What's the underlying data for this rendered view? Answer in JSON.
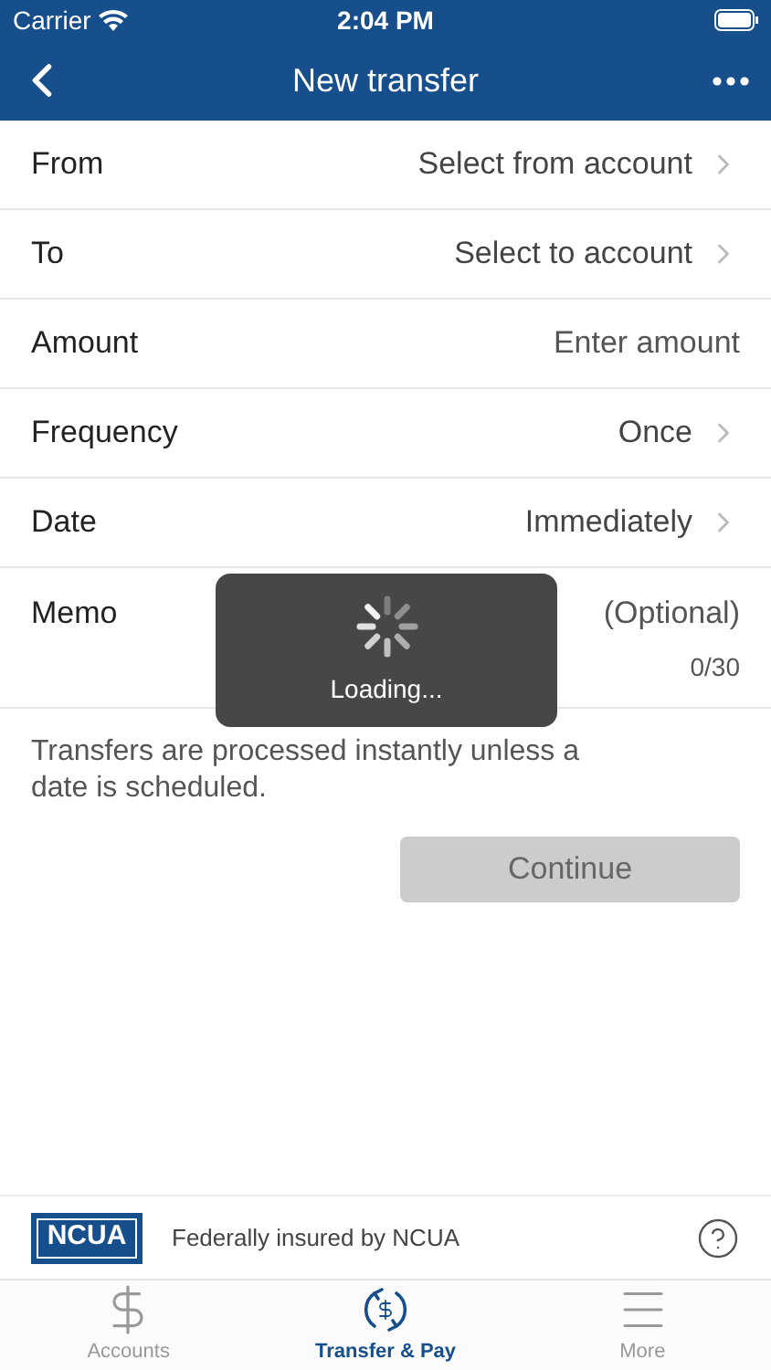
{
  "status_bar": {
    "carrier": "Carrier",
    "time": "2:04 PM"
  },
  "nav": {
    "title": "New transfer"
  },
  "rows": [
    {
      "kind": "select",
      "label": "From",
      "value": "Select from account"
    },
    {
      "kind": "select",
      "label": "To",
      "value": "Select to account"
    },
    {
      "kind": "input",
      "label": "Amount",
      "placeholder": "Enter amount"
    },
    {
      "kind": "select",
      "label": "Frequency",
      "value": "Once"
    },
    {
      "kind": "select",
      "label": "Date",
      "value": "Immediately"
    },
    {
      "kind": "memo",
      "label": "Memo",
      "placeholder": "(Optional)",
      "counter": "0/30"
    }
  ],
  "note": "Transfers are processed instantly unless a date is scheduled.",
  "continue_button": {
    "label": "Continue",
    "disabled": true
  },
  "loading": {
    "label": "Loading..."
  },
  "footer": {
    "logo": "NCUA",
    "text": "Federally insured by NCUA"
  },
  "tabs": [
    {
      "kind": "accounts",
      "label": "Accounts",
      "selected": false
    },
    {
      "kind": "transfer",
      "label": "Transfer & Pay",
      "selected": true
    },
    {
      "kind": "more",
      "label": "More",
      "selected": false
    }
  ]
}
